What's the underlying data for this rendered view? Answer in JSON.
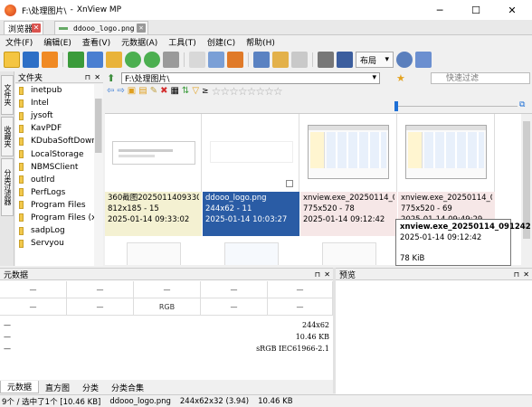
{
  "window": {
    "path": "F:\\处理图片\\",
    "app": "XnView MP",
    "minimize": "─",
    "maximize": "☐",
    "close": "✕"
  },
  "tabs": [
    {
      "label": "浏览器",
      "close": "✕"
    },
    {
      "label": "ddooo_logo.png",
      "close": "✕"
    }
  ],
  "menu": [
    "文件(F)",
    "编辑(E)",
    "查看(V)",
    "元数据(A)",
    "工具(T)",
    "创建(C)",
    "帮助(H)"
  ],
  "toolbar": {
    "layout_label": "布局",
    "layout_arrow": "▾",
    "icons": [
      "folder-open-icon",
      "fullscreen-icon",
      "slideshow-icon",
      "copy-to-icon",
      "move-to-icon",
      "compare-icon",
      "rotate-left-icon",
      "rotate-right-icon",
      "image-adjust-icon",
      "view-mode-icon",
      "filter-icon",
      "bookmark-icon",
      "capture-icon",
      "edit-icon",
      "compare-view-icon",
      "print-icon",
      "convert-icon",
      "settings-icon",
      "help-icon"
    ]
  },
  "left_panel": {
    "tabs": [
      "文件夹",
      "收藏夹",
      "分类过滤器"
    ],
    "header": "文件夹",
    "pin": "⊓",
    "close": "✕",
    "folders": [
      "inetpub",
      "Intel",
      "jysoft",
      "KavPDF",
      "KDubaSoftDown",
      "LocalStorage",
      "NBMSClient",
      "outlrd",
      "PerfLogs",
      "Program Files",
      "Program Files (x",
      "sadpLog",
      "Servyou"
    ]
  },
  "address": {
    "value": "F:\\处理图片\\",
    "arrow": "▾",
    "star": "★",
    "search_placeholder": "快速过滤",
    "search_glyph": "⚲"
  },
  "filter_bar": {
    "ge": "≥",
    "stars": "☆☆☆☆☆☆☆☆"
  },
  "thumbnails": [
    {
      "name": "360截图202501140933027",
      "dims": "812x185 - 15",
      "date": "2025-01-14 09:33:02"
    },
    {
      "name": "ddooo_logo.png",
      "dims": "244x62 - 11",
      "date": "2025-01-14 10:03:27"
    },
    {
      "name": "xnview.exe_20250114_09...",
      "dims": "775x520 - 78",
      "date": "2025-01-14 09:12:42"
    },
    {
      "name": "xnview.exe_20250114_09...",
      "dims": "775x520 - 69",
      "date": "2025-01-14 09:49:29"
    }
  ],
  "tooltip": {
    "name": "xnview.exe_20250114_091242",
    "date": "2025-01-14 09:12:42",
    "size": "78 KiB"
  },
  "meta_panel": {
    "title": "元数据",
    "pin": "⊓",
    "close": "✕",
    "cells": [
      "—",
      "—",
      "—",
      "—",
      "—",
      "—",
      "—",
      "RGB",
      "—",
      "—"
    ],
    "values": [
      {
        "label": "—",
        "value": "244x62"
      },
      {
        "label": "—",
        "value": "10.46 KB"
      },
      {
        "label": "—",
        "value": "sRGB IEC61966-2.1"
      }
    ],
    "tabs": [
      "元数据",
      "直方图",
      "分类",
      "分类合集"
    ]
  },
  "preview_panel": {
    "title": "预览",
    "pin": "⊓",
    "close": "✕"
  },
  "statusbar": {
    "selection": "9个 / 选中了1个 [10.46 KB]",
    "filename": "ddooo_logo.png",
    "dims": "244x62x32 (3.94)",
    "size": "10.46 KB"
  },
  "colors": {
    "selected": "#2a5ca5",
    "accent": "#1d6fd6",
    "folder": "#f2c84b"
  }
}
